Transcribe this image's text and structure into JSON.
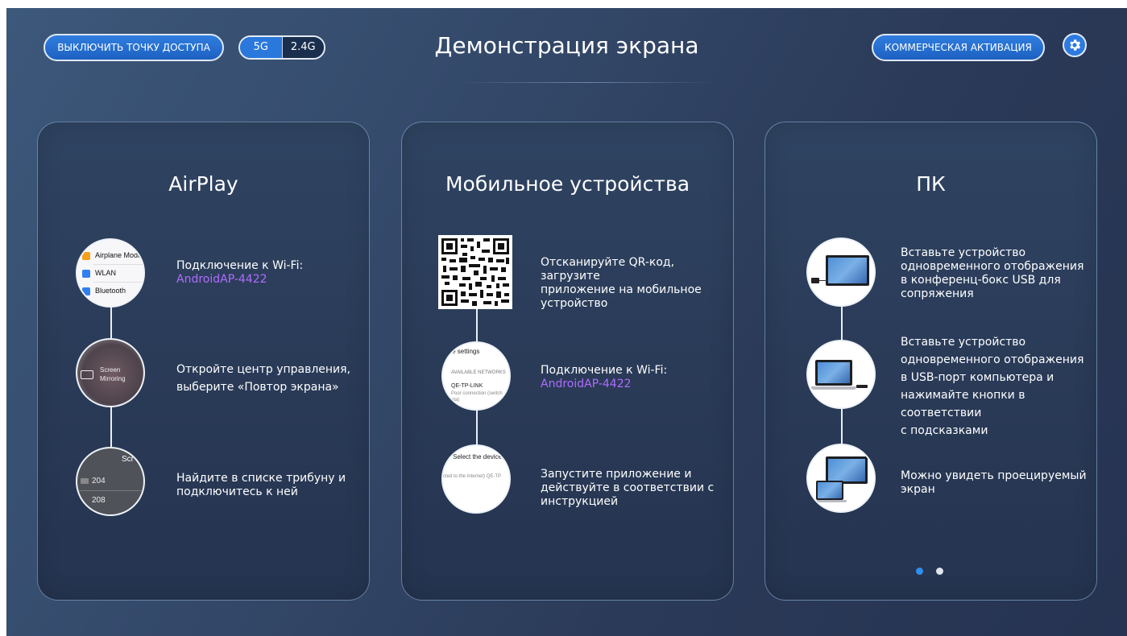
{
  "header": {
    "hotspot_button": "ВЫКЛЮЧИТЬ ТОЧКУ ДОСТУПА",
    "band_5g": "5G",
    "band_24g": "2.4G",
    "title": "Демонстрация экрана",
    "commercial_button": "КОММЕРЧЕСКАЯ АКТИВАЦИЯ",
    "settings_icon": "gear-icon"
  },
  "airplay": {
    "title": "AirPlay",
    "step1": {
      "text": "Подключение к Wi-Fi:",
      "network": "AndroidAP-4422",
      "img": {
        "row1": "Airplane Mode",
        "row2": "WLAN",
        "row3": "Bluetooth"
      }
    },
    "step2": {
      "text_line1": "Откройте центр управления,",
      "text_line2": "выберите «Повтор экрана»",
      "img": {
        "line1": "Screen",
        "line2": "Mirroring"
      }
    },
    "step3": {
      "text_line1": "Найдите в списке трибуну и",
      "text_line2": "подключитесь к ней",
      "img": {
        "header": "Scr",
        "row1": "204",
        "row2": "208"
      }
    }
  },
  "mobile": {
    "title": "Мобильное устройства",
    "step1": {
      "text_line1": "Отсканируйте QR-код, загрузите",
      "text_line2": "приложение на мобильное",
      "text_line3": "устройство"
    },
    "step2": {
      "text": "Подключение к Wi-Fi:",
      "network": "AndroidAP-4422",
      "img": {
        "line1": "ore settings",
        "line2": "AVAILABLE NETWORKS",
        "line3": "QE-TP-LINK",
        "line4": "Poor connection (switch",
        "line5": "ata)"
      }
    },
    "step3": {
      "text_line1": "Запустите приложение и",
      "text_line2": "действуйте в соответствии с",
      "text_line3": "инструкцией",
      "img": {
        "line1": "Select the device",
        "line2": "cted to the Internet) QE-TP"
      }
    }
  },
  "pc": {
    "title": "ПК",
    "step1": {
      "text_line1": "Вставьте устройство",
      "text_line2": "одновременного отображения",
      "text_line3": "в конференц-бокс USB для",
      "text_line4": "сопряжения"
    },
    "step2": {
      "text_line1": "Вставьте устройство",
      "text_line2": "одновременного отображения",
      "text_line3": "в USB-порт компьютера и",
      "text_line4": "нажимайте кнопки в соответствии",
      "text_line5": "с подсказками"
    },
    "step3": {
      "text_line1": "Можно увидеть проецируемый",
      "text_line2": "экран"
    },
    "page_active": 1,
    "page_count": 2
  },
  "colors": {
    "accent": "#2b78dc",
    "highlight": "#b06cff",
    "dot_active": "#2f8ff0",
    "dot_inactive": "#dfe6ef"
  }
}
